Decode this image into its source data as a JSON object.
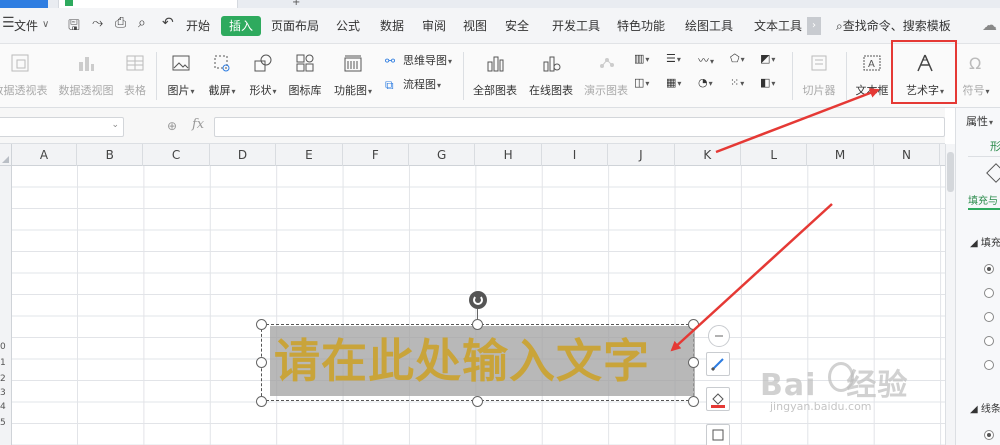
{
  "title_strip": {
    "home_tab_color": "#2e7de1",
    "doc_icon_color": "#2eaa5e"
  },
  "menubar": {
    "file_menu": "文件",
    "start": "开始",
    "insert": "插入",
    "page_layout": "页面布局",
    "formula": "公式",
    "data": "数据",
    "review": "审阅",
    "view": "视图",
    "security": "安全",
    "developer": "开发工具",
    "special": "特色功能",
    "drawing_tools": "绘图工具",
    "text_tools": "文本工具",
    "search": "查找命令、搜索模板",
    "accent_color": "#2eaa5e"
  },
  "ribbon": {
    "pivot_table": "数据透视表",
    "pivot_chart": "数据透视图",
    "table": "表格",
    "picture": "图片",
    "screenshot": "截屏",
    "shapes": "形状",
    "icon_library": "图标库",
    "function_chart": "功能图",
    "mind_map": "思维导图",
    "flowchart": "流程图",
    "all_charts": "全部图表",
    "online_chart": "在线图表",
    "demo_chart": "演示图表",
    "slicer": "切片器",
    "textbox": "文本框",
    "wordart": "艺术字",
    "symbol": "符号"
  },
  "formula_bar": {
    "fx": "fx"
  },
  "columns": [
    "A",
    "B",
    "C",
    "D",
    "E",
    "F",
    "G",
    "H",
    "I",
    "J",
    "K",
    "L",
    "M",
    "N"
  ],
  "rows": [
    "0",
    "1",
    "2",
    "3",
    "4",
    "5"
  ],
  "wordart": {
    "text": "请在此处输入文字",
    "text_color": "#c9a43a"
  },
  "right_pane": {
    "title": "属性",
    "tab": "形",
    "fill_stroke": "填充与",
    "fill_section": "填充",
    "line_section": "线条"
  },
  "annotation": {
    "highlight_color": "#e53935"
  },
  "watermark": {
    "brand": "Bai",
    "brand_suffix": "经验",
    "url": "jingyan.baidu.com"
  }
}
